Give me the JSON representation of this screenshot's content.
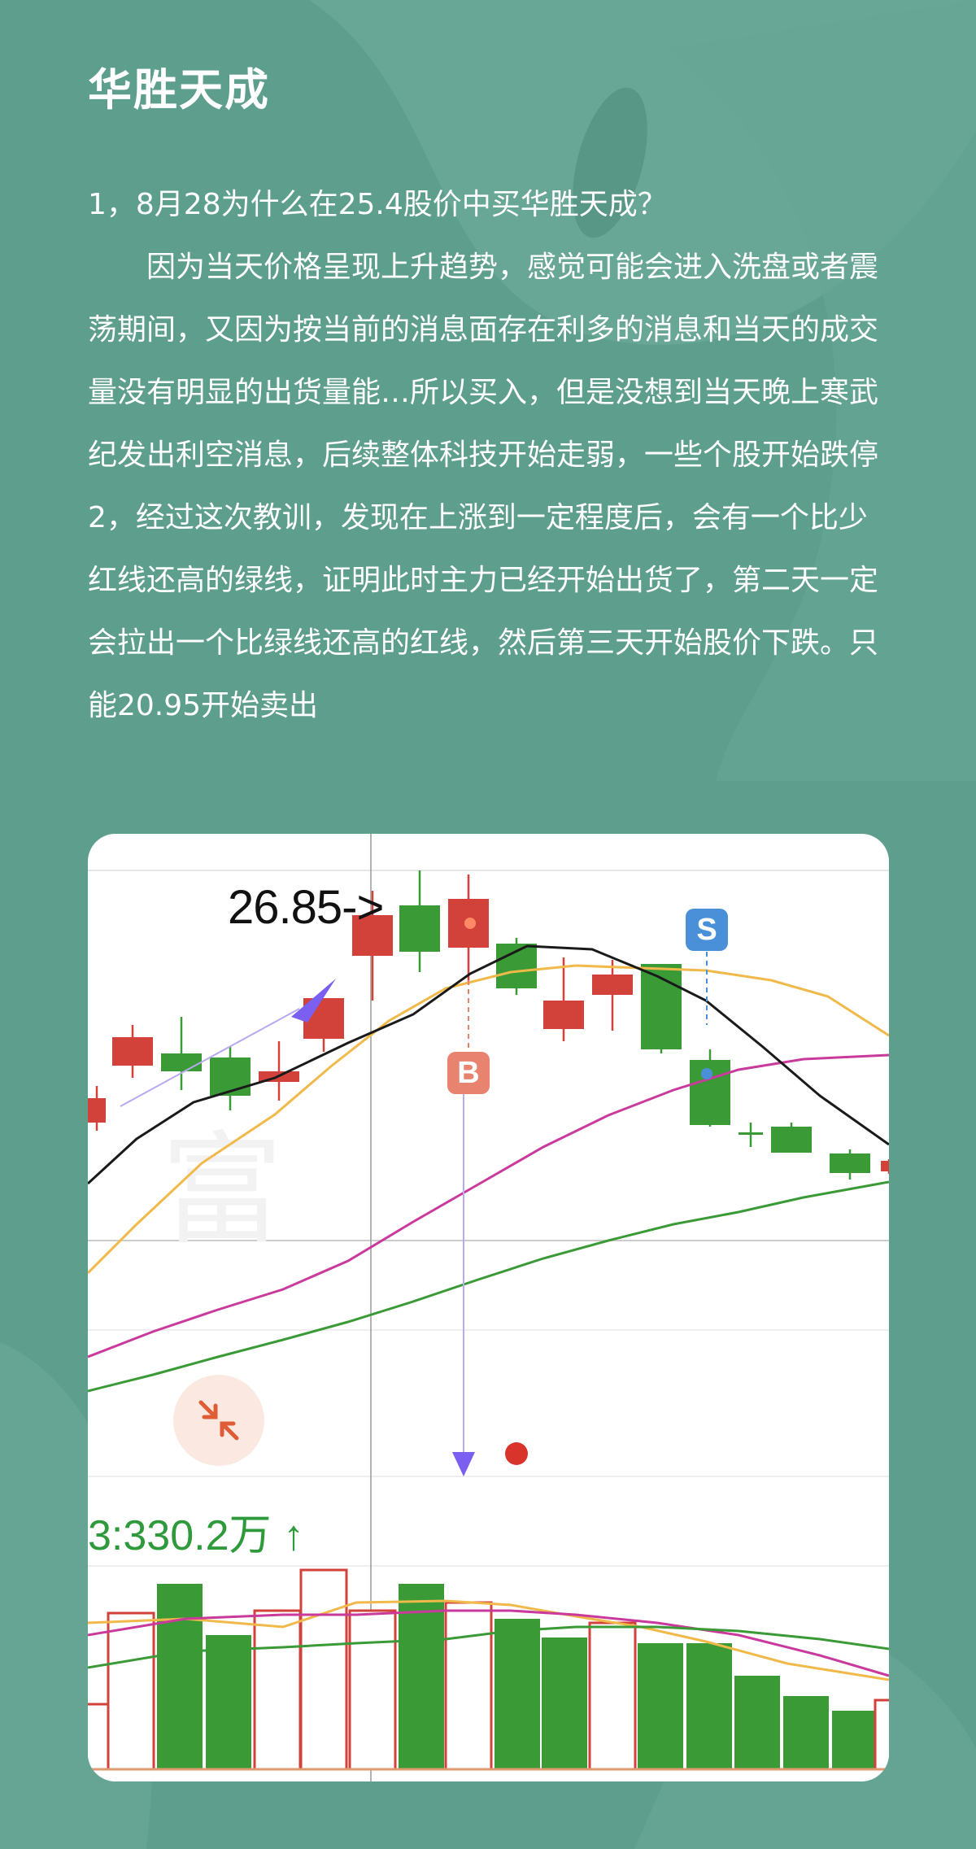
{
  "page": {
    "title": "华胜天成",
    "paragraphs": [
      "1，8月28为什么在25.4股价中买华胜天成？",
      "因为当天价格呈现上升趋势，感觉可能会进入洗盘或者震荡期间，又因为按当前的消息面存在利多的消息和当天的成交量没有明显的出货量能…所以买入，但是没想到当天晚上寒武纪发出利空消息，后续整体科技开始走弱，一些个股开始跌停",
      "2，经过这次教训，发现在上涨到一定程度后，会有一个比少红线还高的绿线，证明此时主力已经开始出货了，第二天一定会拉出一个比绿线还高的红线，然后第三天开始股价下跌。只能20.95开始卖出"
    ]
  },
  "chart": {
    "price_label": "26.85->",
    "sell_badge": "S",
    "buy_badge": "B",
    "volume_label": "3:330.2万 ↑",
    "colors": {
      "up": "#d2413a",
      "down": "#3a9a36",
      "ma5": "#1a1a1a",
      "ma10": "#f0b94a",
      "ma20": "#c93a9c",
      "ma60": "#3a9a36"
    },
    "candles": [
      {
        "type": "up"
      },
      {
        "type": "up"
      },
      {
        "type": "down"
      },
      {
        "type": "down"
      },
      {
        "type": "up"
      },
      {
        "type": "up"
      },
      {
        "type": "up"
      },
      {
        "type": "down"
      },
      {
        "type": "up"
      },
      {
        "type": "down"
      },
      {
        "type": "up"
      },
      {
        "type": "up"
      },
      {
        "type": "down"
      },
      {
        "type": "down"
      },
      {
        "type": "down"
      },
      {
        "type": "down"
      },
      {
        "type": "down"
      },
      {
        "type": "up"
      }
    ]
  }
}
